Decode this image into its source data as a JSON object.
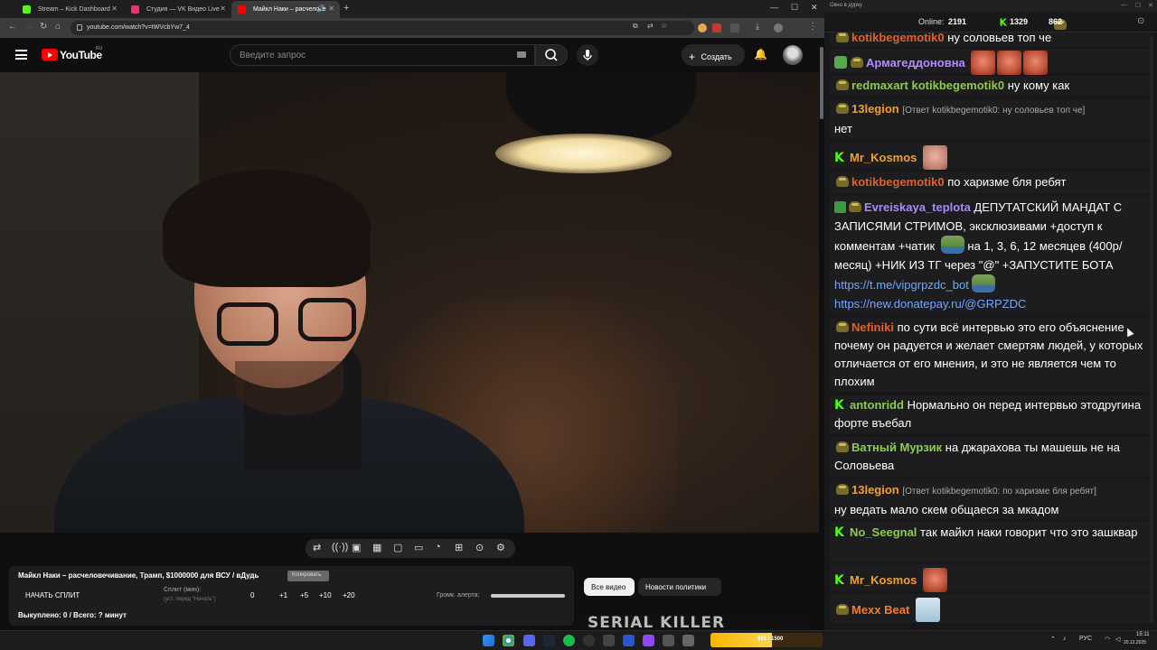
{
  "browser": {
    "tabs": [
      {
        "title": "Stream – Kick Dashboard"
      },
      {
        "title": "Студия — VK Видео Live"
      },
      {
        "title": "Майкл Наки – расчелове"
      }
    ],
    "url": "youtube.com/watch?v=tWVcbYw7_4",
    "badge_count": "594"
  },
  "youtube": {
    "logo_text": "YouTube",
    "country": "RU",
    "search_placeholder": "Введите запрос",
    "create_label": "Создать"
  },
  "panel": {
    "video_title": "Майкл Наки – расчеловечивание, Трамп, $1000000 для ВСУ / вДудь",
    "copy_label": "Копировать",
    "split_button": "НАЧАТЬ СПЛИТ",
    "split_label": "Сплит (мин):",
    "split_hint": "(уст. перед \"Начать\")",
    "split_value": "0",
    "increments": [
      "+1",
      "+5",
      "+10",
      "+20"
    ],
    "alert_volume_label": "Громк. алерта:",
    "alert_volume": 1.0,
    "bought": "Выкуплено: 0 / Всего: ? минут"
  },
  "chips": [
    "Все видео",
    "Новости политики"
  ],
  "thumbnail_text": "SERIAL KILLER",
  "chat": {
    "window_title": "Окно в дурку",
    "online_label": "Online:",
    "online": "2191",
    "kick_count": "1329",
    "vk_count": "862",
    "messages": [
      {
        "nick": "kotikbegemotik0",
        "text": "ну соловьев топ че"
      },
      {
        "nick": "Армагеддоновна",
        "text": ""
      },
      {
        "nick": "redmaxart",
        "nick2": "kotikbegemotik0",
        "text": "ну кому как"
      },
      {
        "nick": "13legion",
        "reply": "[Ответ kotikbegemotik0: ну соловьев топ че]",
        "text": "нет"
      },
      {
        "nick": "Mr_Kosmos",
        "text": ""
      },
      {
        "nick": "kotikbegemotik0",
        "text": "по харизме бля ребят"
      },
      {
        "nick": "Evreiskaya_teplota",
        "text1": "ДЕПУТАТСКИЙ МАНДАТ С ЗАПИСЯМИ СТРИМОВ, эксклюзивами +доступ к комментам +чатик",
        "text2": "на 1, 3, 6, 12 месяцев (400р/месяц) +НИК ИЗ ТГ через \"@\" +ЗАПУСТИТЕ БОТА",
        "link1": "https://t.me/vipgrpzdc_bot",
        "link2": "https://new.donatepay.ru/@GRPZDC"
      },
      {
        "nick": "Nefiniki",
        "text": "по сути всё интервью это его объяснение почему он радуется и желает смертям людей, у которых отличается от его мнения, и это не является чем то плохим"
      },
      {
        "nick": "antonridd",
        "text": "Нормально он перед интервью этодругина форте въебал"
      },
      {
        "nick": "Ватный Мурзик",
        "text": "на джарахова ты машешь не на Соловьева"
      },
      {
        "nick": "13legion",
        "reply": "[Ответ kotikbegemotik0: по харизме бля ребят]",
        "text": "ну ведать мало скем общаеся за  мкадом"
      },
      {
        "nick": "No_Seegnal",
        "text": "так майкл наки говорит что это зашквар"
      },
      {
        "nick": "Mr_Kosmos",
        "text": ""
      },
      {
        "nick": "Mexx Beat",
        "text": ""
      }
    ]
  },
  "taskbar": {
    "goal_text": "825 / 1500",
    "goal_progress": 0.55,
    "lang": "РУС",
    "time": "15:11",
    "date": "20.12.2025"
  },
  "colors": {
    "nick_kotik": "#e0622a",
    "nick_arm": "#b48bff",
    "nick_green": "#8ecb4a",
    "nick_orange": "#f0a030",
    "kick_green": "#53fc18",
    "nick_mexx": "#ff7a1a",
    "nick_evreiskaya": "#a78bfa"
  }
}
